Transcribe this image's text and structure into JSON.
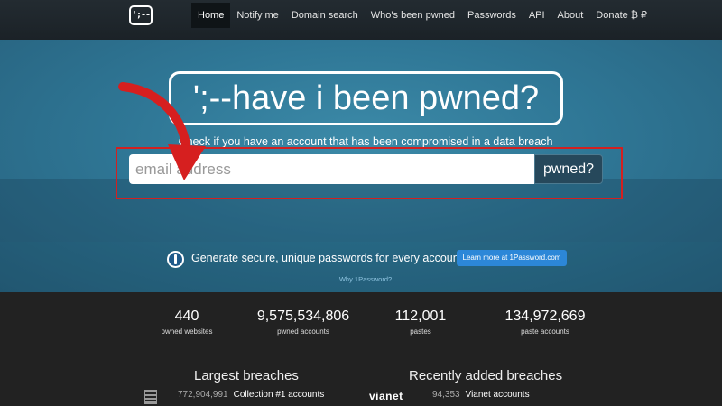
{
  "navbar": {
    "logo_text": "';--",
    "items": [
      {
        "label": "Home",
        "active": true
      },
      {
        "label": "Notify me"
      },
      {
        "label": "Domain search"
      },
      {
        "label": "Who's been pwned"
      },
      {
        "label": "Passwords"
      },
      {
        "label": "API"
      },
      {
        "label": "About"
      },
      {
        "label": "Donate ₿ ₽"
      }
    ]
  },
  "hero": {
    "title": "';--have i been pwned?",
    "subtitle": "Check if you have an account that has been compromised in a data breach"
  },
  "search": {
    "placeholder": "email address",
    "button_label": "pwned?"
  },
  "promo": {
    "text": "Generate secure, unique passwords for every account",
    "button_label": "Learn more at 1Password.com",
    "link_text": "Why 1Password?"
  },
  "stats": [
    {
      "value": "440",
      "label": "pwned websites"
    },
    {
      "value": "9,575,534,806",
      "label": "pwned accounts"
    },
    {
      "value": "112,001",
      "label": "pastes"
    },
    {
      "value": "134,972,669",
      "label": "paste accounts"
    }
  ],
  "largest_breaches": {
    "heading": "Largest breaches",
    "items": [
      {
        "count": "772,904,991",
        "name": "Collection #1 accounts"
      }
    ]
  },
  "recent_breaches": {
    "heading": "Recently added breaches",
    "items": [
      {
        "logo": "vianet",
        "count": "94,353",
        "name": "Vianet accounts"
      }
    ]
  },
  "colors": {
    "hero": "#2f7796",
    "navbar": "#1b2227",
    "highlight": "#d32020",
    "search_button": "#26485b",
    "promo_button": "#2c87d8"
  }
}
